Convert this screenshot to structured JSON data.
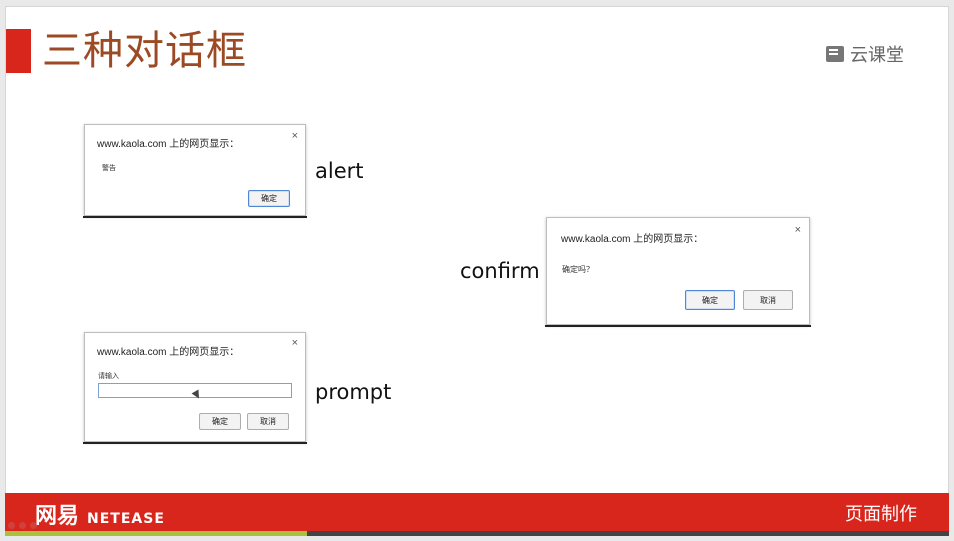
{
  "slide": {
    "title": "三种对话框",
    "brand": "云课堂",
    "brand_icon": "book-icon",
    "accent_color": "#d9261c"
  },
  "captions": {
    "alert": "alert",
    "confirm": "confirm",
    "prompt": "prompt"
  },
  "alert_dialog": {
    "title": "www.kaola.com 上的网页显示：",
    "close": "×",
    "message": "警告",
    "ok_label": "确定"
  },
  "confirm_dialog": {
    "title": "www.kaola.com 上的网页显示：",
    "close": "×",
    "message": "确定吗？",
    "ok_label": "确定",
    "cancel_label": "取消"
  },
  "prompt_dialog": {
    "title": "www.kaola.com 上的网页显示：",
    "close": "×",
    "message": "请输入",
    "input_value": "",
    "ok_label": "确定",
    "cancel_label": "取消"
  },
  "footer": {
    "logo_cn": "网易",
    "logo_en": "NETEASE",
    "right_text": "页面制作",
    "color": "#d9261c"
  },
  "player": {
    "progress": 0.32
  }
}
